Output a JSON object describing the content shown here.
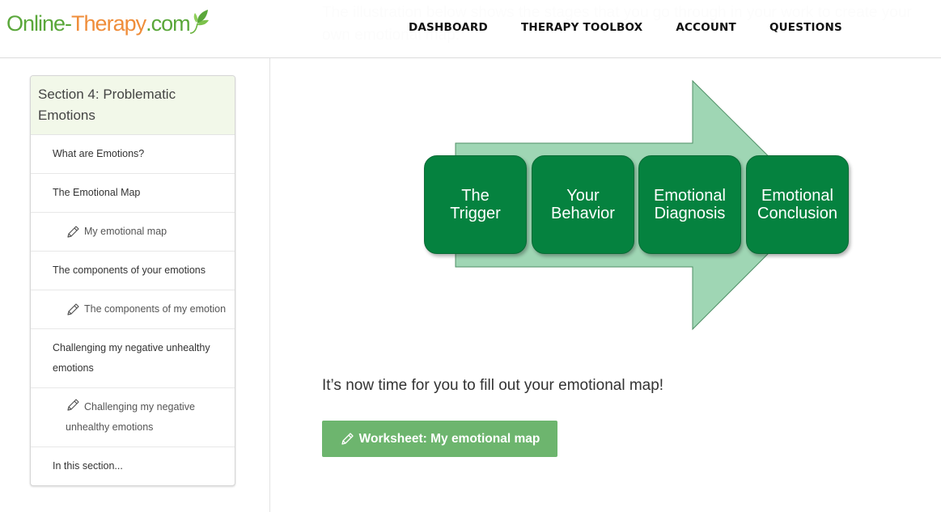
{
  "header": {
    "logo": {
      "part1": "Online-",
      "part2": "Therapy",
      "part3": ".com",
      "icon": "leaf-icon"
    },
    "nav": [
      {
        "label": "DASHBOARD"
      },
      {
        "label": "THERAPY TOOLBOX"
      },
      {
        "label": "ACCOUNT"
      },
      {
        "label": "QUESTIONS"
      }
    ]
  },
  "main": {
    "intro_text_faded": "The illustration below shows the stages that you go through in your work to create your own emotional map.",
    "diagram": {
      "steps": [
        {
          "line1": "The",
          "line2": "Trigger"
        },
        {
          "line1": "Your",
          "line2": "Behavior"
        },
        {
          "line1": "Emotional",
          "line2": "Diagnosis"
        },
        {
          "line1": "Emotional",
          "line2": "Conclusion"
        }
      ],
      "colors": {
        "box": "#05823f",
        "arrow": "#9fd6b4"
      }
    },
    "prompt": "It’s now time for you to fill out your emotional map!",
    "worksheet_button": {
      "label": "Worksheet: My emotional map",
      "icon": "pencil-icon",
      "color": "#6db56e"
    }
  },
  "sidebar": {
    "title": "Section 4: Problematic Emotions",
    "items": [
      {
        "label": "What are Emotions?",
        "type": "lesson"
      },
      {
        "label": "The Emotional Map",
        "type": "lesson"
      },
      {
        "label": "My emotional map",
        "type": "worksheet",
        "icon": "pencil-icon"
      },
      {
        "label": "The components of your emotions",
        "type": "lesson"
      },
      {
        "label": "The components of my emotion",
        "type": "worksheet",
        "icon": "pencil-icon"
      },
      {
        "label": "Challenging my negative unhealthy emotions",
        "type": "lesson"
      },
      {
        "label": "Challenging my negative unhealthy emotions",
        "type": "worksheet",
        "icon": "pencil-icon"
      },
      {
        "label": "In this section...",
        "type": "lesson"
      }
    ],
    "title_bg": "#f2f8e9"
  }
}
